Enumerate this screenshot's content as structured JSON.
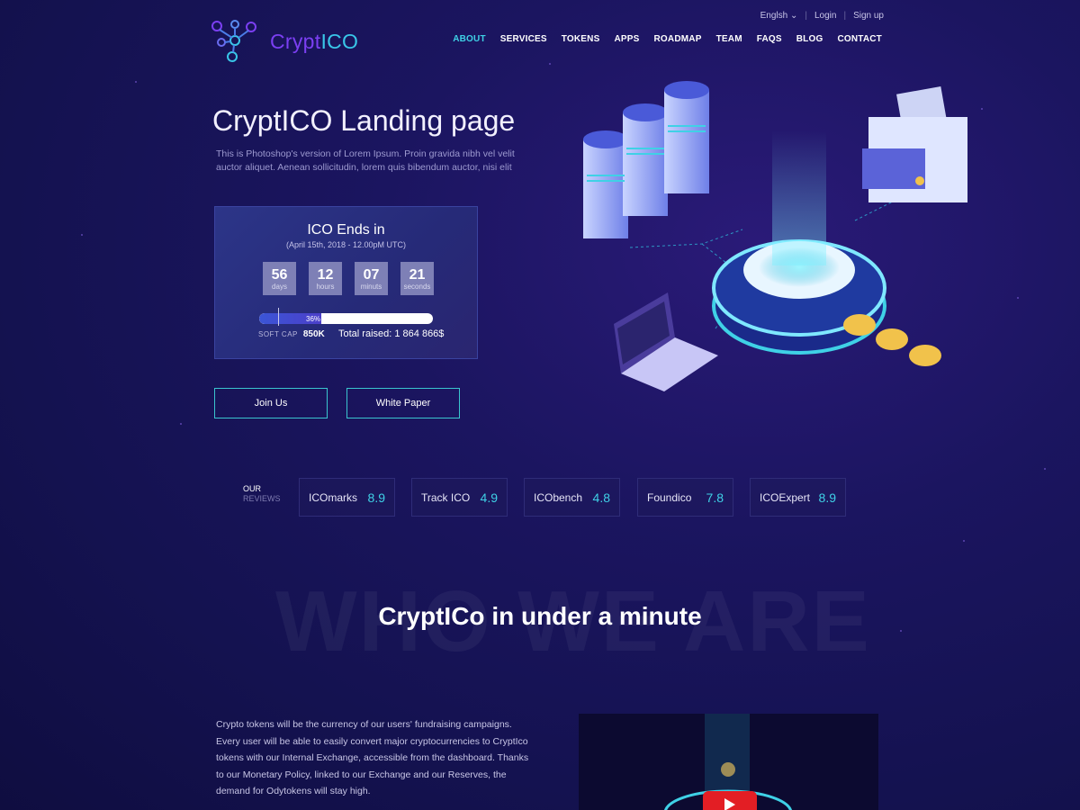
{
  "header": {
    "logo": {
      "part1": "Crypt",
      "part2": "ICO"
    },
    "topbar": {
      "language": "Englsh",
      "login": "Login",
      "signup": "Sign up"
    },
    "nav": [
      "ABOUT",
      "SERVICES",
      "TOKENS",
      "APPS",
      "ROADMAP",
      "TEAM",
      "FAQS",
      "BLOG",
      "CONTACT"
    ],
    "active_nav": "ABOUT"
  },
  "hero": {
    "title": "CryptICO Landing page",
    "subtitle": "This is Photoshop's version  of Lorem Ipsum. Proin gravida nibh vel velit auctor aliquet. Aenean sollicitudin, lorem quis bibendum auctor, nisi elit",
    "ico": {
      "title": "ICO Ends in",
      "date": "(April 15th, 2018 - 12.00pM UTC)",
      "countdown": [
        {
          "value": "56",
          "label": "days"
        },
        {
          "value": "12",
          "label": "hours"
        },
        {
          "value": "07",
          "label": "minuts"
        },
        {
          "value": "21",
          "label": "seconds"
        }
      ],
      "progress_percent": 36,
      "progress_label": "36%",
      "soft_cap_label": "SOFT CAP",
      "soft_cap_value": "850K",
      "raised": "Total raised: 1 864 866$"
    },
    "buttons": {
      "join": "Join Us",
      "white_paper": "White Paper"
    }
  },
  "reviews": {
    "label_top": "OUR",
    "label_bottom": "REVIEWS",
    "items": [
      {
        "name": "ICOmarks",
        "score": "8.9"
      },
      {
        "name": "Track ICO",
        "score": "4.9"
      },
      {
        "name": "ICObench",
        "score": "4.8"
      },
      {
        "name": "Foundico",
        "score": "7.8"
      },
      {
        "name": "ICOExpert",
        "score": "8.9"
      }
    ]
  },
  "who": {
    "bg_word": "WHO WE ARE",
    "title": "CryptICo in under a minute",
    "text": "Crypto tokens will be the currency of our users' fundraising campaigns. Every user will be able to easily convert major cryptocurrencies to CryptIco tokens with our Internal Exchange, accessible from the dashboard. Thanks to our Monetary Policy, linked to our Exchange and our Reserves, the demand for Odytokens will stay high."
  },
  "colors": {
    "accent": "#3fd1e6",
    "brand_purple": "#7b3ff2",
    "background": "#1b1560"
  }
}
